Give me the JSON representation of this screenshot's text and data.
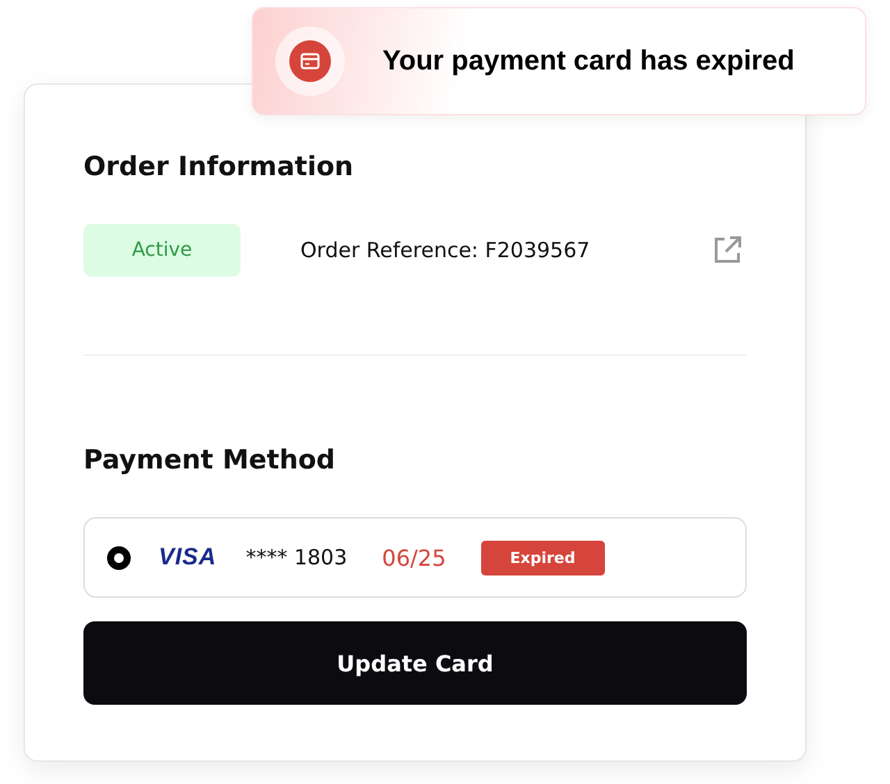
{
  "toast": {
    "message": "Your payment card has expired"
  },
  "order": {
    "title": "Order Information",
    "status": "Active",
    "reference": "Order Reference: F2039567"
  },
  "payment": {
    "title": "Payment Method",
    "cards": [
      {
        "selected": true,
        "brand": "VISA",
        "number": "**** 1803",
        "expiry": "06/25",
        "badge": "Expired"
      }
    ],
    "button": "Update Card"
  }
}
